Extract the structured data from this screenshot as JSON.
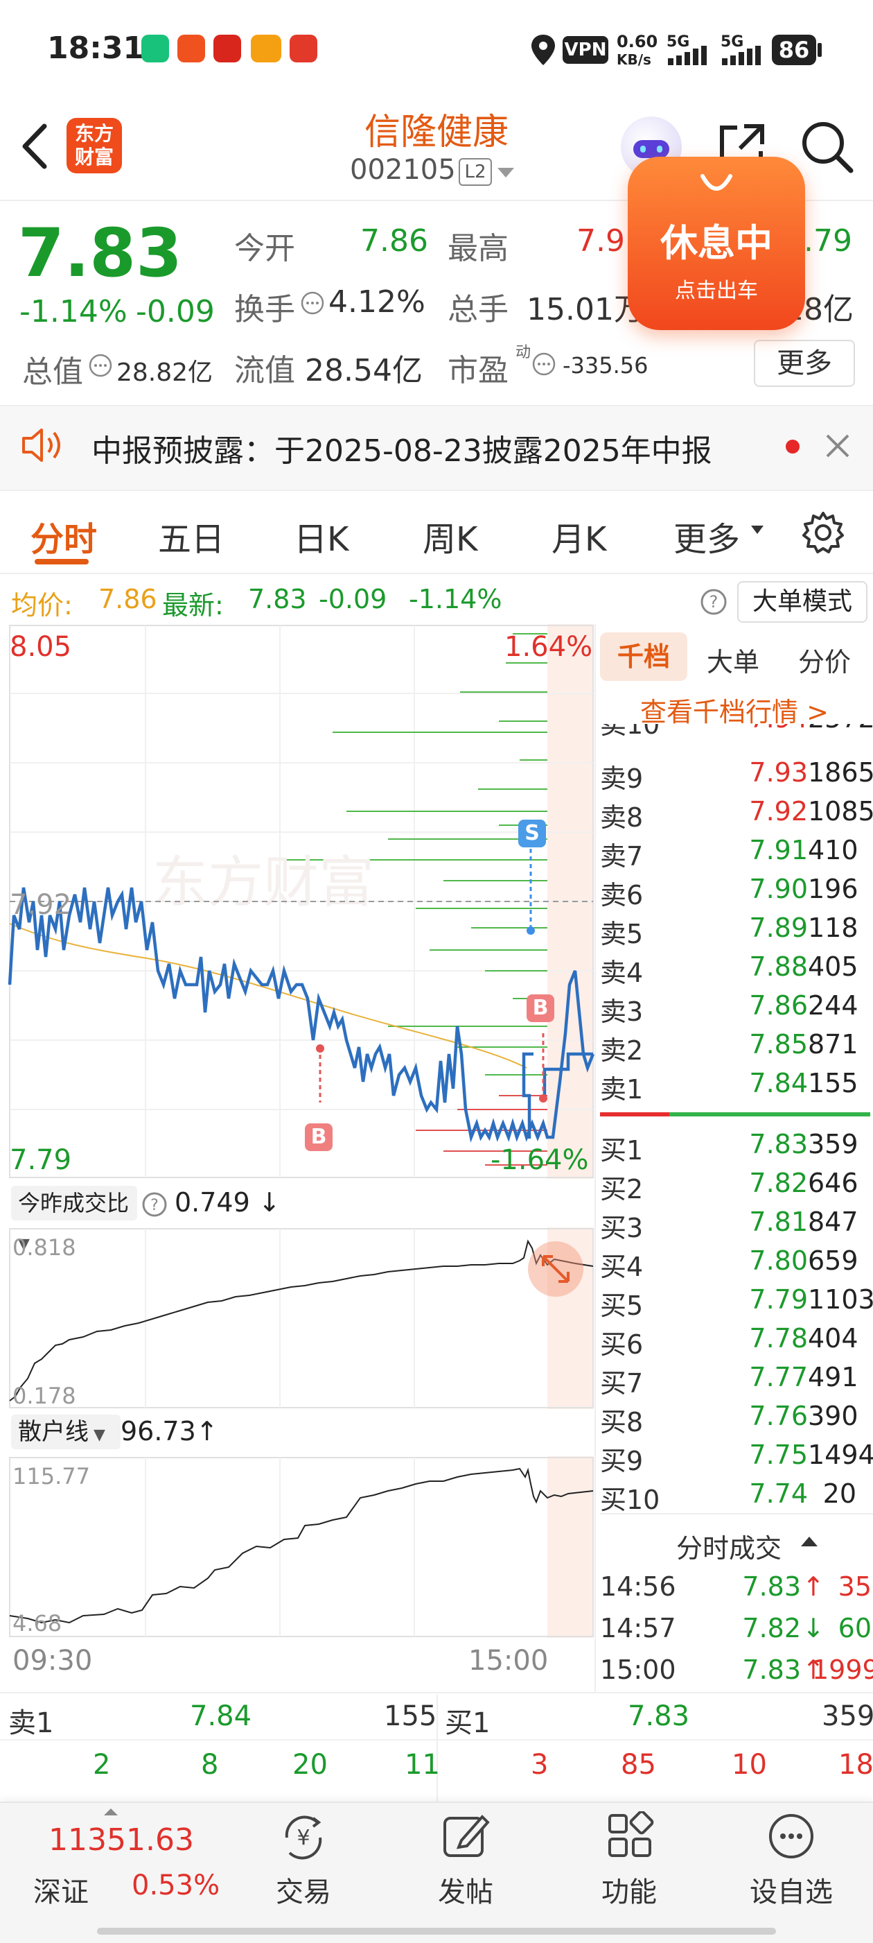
{
  "status_bar": {
    "time": "18:31",
    "net_speed": "0.60",
    "net_unit": "KB/s",
    "sig1": "5G",
    "sig2": "5G",
    "battery": "86",
    "vpn": "VPN"
  },
  "header": {
    "stock_name": "信隆健康",
    "stock_code": "002105",
    "level_badge": "L2",
    "logo_line1": "东方",
    "logo_line2": "财富",
    "break_badge_title": "休息中",
    "break_badge_sub": "点击出车"
  },
  "quote": {
    "price": "7.83",
    "change_pct": "-1.14%",
    "change": "-0.09",
    "open_label": "今开",
    "open_value": "7.86",
    "high_label": "最高",
    "high_value": "7.9",
    "low_value_partial": ".79",
    "turnover_label": "换手",
    "turnover_value": "4.12%",
    "volume_label": "总手",
    "volume_value": "15.01万",
    "amount_partial": "18亿",
    "mcap_label": "总值",
    "mcap_value": "28.82亿",
    "float_label": "流值",
    "float_value": "28.54亿",
    "pe_label": "市盈",
    "pe_sup": "动",
    "pe_value": "-335.56",
    "more_label": "更多"
  },
  "notice": {
    "text": "中报预披露：于2025-08-23披露2025年中报"
  },
  "tabs": [
    "分时",
    "五日",
    "日K",
    "周K",
    "月K",
    "更多"
  ],
  "info_line": {
    "avg_label": "均价:",
    "avg_value": "7.86",
    "latest_label": "最新:",
    "latest_value": "7.83",
    "change": "-0.09",
    "change_pct": "-1.14%",
    "mode_label": "大单模式"
  },
  "chart": {
    "y_max": "8.05",
    "y_max_pct": "1.64%",
    "y_ref": "7.92",
    "y_min": "7.79",
    "y_min_pct": "-1.64%",
    "x_start": "09:30",
    "x_end": "15:00",
    "watermark": "东方财富",
    "marker_s": "S",
    "marker_b": "B"
  },
  "chart_data": {
    "type": "line",
    "x_range": [
      "09:30",
      "15:00"
    ],
    "ylim": [
      7.79,
      8.05
    ],
    "price_series_approx": [
      7.86,
      7.92,
      7.88,
      7.9,
      7.91,
      7.89,
      7.88,
      7.88,
      7.86,
      7.85,
      7.86,
      7.84,
      7.83,
      7.81,
      7.8,
      7.8,
      7.79,
      7.8,
      7.79,
      7.79,
      7.85,
      7.87,
      7.82,
      7.84,
      7.84
    ],
    "avg_series_approx": [
      7.93,
      7.9,
      7.89,
      7.89,
      7.88,
      7.88,
      7.87,
      7.87,
      7.87,
      7.86,
      7.86,
      7.86,
      7.86,
      7.86,
      7.86,
      7.86,
      7.86
    ]
  },
  "ratio_panel": {
    "label": "今昨成交比",
    "value": "0.749",
    "arrow": "↓",
    "max": "0.818",
    "min": "0.178"
  },
  "retail_panel": {
    "label": "散户线",
    "value": "96.73",
    "arrow": "↑",
    "max": "115.77",
    "min": "4.68"
  },
  "orderbook": {
    "tabs": [
      "千档",
      "大单",
      "分价"
    ],
    "link": "查看千档行情 >",
    "asks": [
      {
        "label": "卖10",
        "price": "7.94",
        "vol": "2572"
      },
      {
        "label": "卖9",
        "price": "7.93",
        "vol": "1865"
      },
      {
        "label": "卖8",
        "price": "7.92",
        "vol": "1085"
      },
      {
        "label": "卖7",
        "price": "7.91",
        "vol": "410"
      },
      {
        "label": "卖6",
        "price": "7.90",
        "vol": "196"
      },
      {
        "label": "卖5",
        "price": "7.89",
        "vol": "118"
      },
      {
        "label": "卖4",
        "price": "7.88",
        "vol": "405"
      },
      {
        "label": "卖3",
        "price": "7.86",
        "vol": "244"
      },
      {
        "label": "卖2",
        "price": "7.85",
        "vol": "871"
      },
      {
        "label": "卖1",
        "price": "7.84",
        "vol": "155"
      }
    ],
    "bids": [
      {
        "label": "买1",
        "price": "7.83",
        "vol": "359"
      },
      {
        "label": "买2",
        "price": "7.82",
        "vol": "646"
      },
      {
        "label": "买3",
        "price": "7.81",
        "vol": "847"
      },
      {
        "label": "买4",
        "price": "7.80",
        "vol": "659"
      },
      {
        "label": "买5",
        "price": "7.79",
        "vol": "1103"
      },
      {
        "label": "买6",
        "price": "7.78",
        "vol": "404"
      },
      {
        "label": "买7",
        "price": "7.77",
        "vol": "491"
      },
      {
        "label": "买8",
        "price": "7.76",
        "vol": "390"
      },
      {
        "label": "买9",
        "price": "7.75",
        "vol": "1494"
      },
      {
        "label": "买10",
        "price": "7.74",
        "vol": "20"
      }
    ],
    "trades_title": "分时成交",
    "trades": [
      {
        "time": "14:56",
        "price": "7.83",
        "arrow": "↑",
        "vol": "35"
      },
      {
        "time": "14:57",
        "price": "7.82",
        "arrow": "↓",
        "vol": "60"
      },
      {
        "time": "15:00",
        "price": "7.83",
        "arrow": "↑",
        "vol": "1999"
      }
    ]
  },
  "bottom_quote": {
    "ask_label": "卖1",
    "ask_price": "7.84",
    "ask_vol": "155",
    "bid_label": "买1",
    "bid_price": "7.83",
    "bid_vol": "359",
    "ask_queue": [
      "2",
      "8",
      "20",
      "11"
    ],
    "bid_queue": [
      "3",
      "85",
      "10",
      "18"
    ]
  },
  "bottom_nav": {
    "index_value": "11351.63",
    "index_name": "深证",
    "index_change": "0.53%",
    "items": [
      "交易",
      "发帖",
      "功能",
      "设自选"
    ]
  }
}
